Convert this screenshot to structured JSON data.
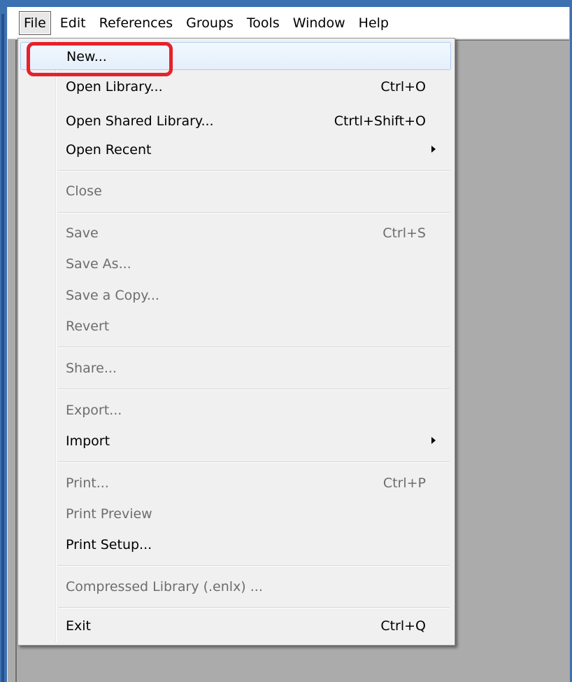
{
  "menubar": {
    "items": [
      "File",
      "Edit",
      "References",
      "Groups",
      "Tools",
      "Window",
      "Help"
    ],
    "active": "File"
  },
  "file_menu": {
    "new": {
      "label": "New...",
      "shortcut": ""
    },
    "open_library": {
      "label": "Open Library...",
      "shortcut": "Ctrl+O"
    },
    "open_shared_library": {
      "label": "Open Shared Library...",
      "shortcut": "Ctrtl+Shift+O"
    },
    "open_recent": {
      "label": "Open Recent",
      "submenu": true
    },
    "close": {
      "label": "Close",
      "disabled": true
    },
    "save": {
      "label": "Save",
      "shortcut": "Ctrl+S",
      "disabled": true
    },
    "save_as": {
      "label": "Save As...",
      "disabled": true
    },
    "save_a_copy": {
      "label": "Save a Copy...",
      "disabled": true
    },
    "revert": {
      "label": "Revert",
      "disabled": true
    },
    "share": {
      "label": "Share...",
      "disabled": true
    },
    "export": {
      "label": "Export...",
      "disabled": true
    },
    "import": {
      "label": "Import",
      "submenu": true
    },
    "print": {
      "label": "Print...",
      "shortcut": "Ctrl+P",
      "disabled": true
    },
    "print_preview": {
      "label": "Print Preview",
      "disabled": true
    },
    "print_setup": {
      "label": "Print Setup..."
    },
    "compressed_library": {
      "label": "Compressed Library (.enlx) ...",
      "disabled": true
    },
    "exit": {
      "label": "Exit",
      "shortcut": "Ctrl+Q"
    }
  },
  "highlighted_item": "New...",
  "colors": {
    "window_border": "#3c71b1",
    "workspace": "#ababab",
    "menu_background": "#f0f0f0",
    "disabled_text": "#6d6d6d",
    "annotation": "#e8202a",
    "highlight_border": "#aecdf0"
  }
}
